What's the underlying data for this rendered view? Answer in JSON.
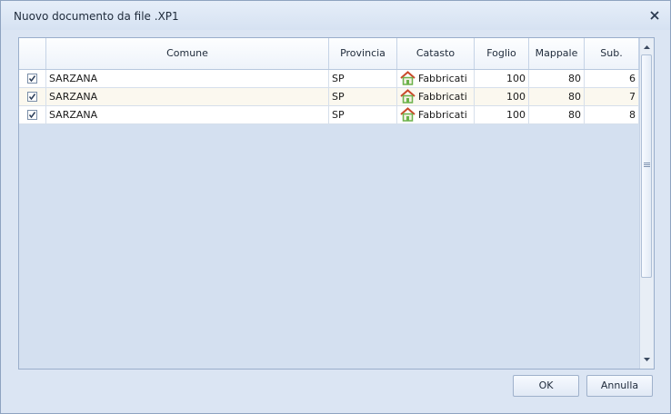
{
  "window": {
    "title": "Nuovo documento da file .XP1"
  },
  "grid": {
    "columns": [
      "",
      "Comune",
      "Provincia",
      "Catasto",
      "Foglio",
      "Mappale",
      "Sub."
    ],
    "rows": [
      {
        "checked": true,
        "comune": "SARZANA",
        "provincia": "SP",
        "catasto": "Fabbricati",
        "foglio": "100",
        "mappale": "80",
        "sub": "6"
      },
      {
        "checked": true,
        "comune": "SARZANA",
        "provincia": "SP",
        "catasto": "Fabbricati",
        "foglio": "100",
        "mappale": "80",
        "sub": "7"
      },
      {
        "checked": true,
        "comune": "SARZANA",
        "provincia": "SP",
        "catasto": "Fabbricati",
        "foglio": "100",
        "mappale": "80",
        "sub": "8"
      }
    ],
    "catasto_icon": "house-icon"
  },
  "buttons": {
    "ok": "OK",
    "cancel": "Annulla"
  },
  "colors": {
    "row_alt": "#fbf8ef",
    "row": "#ffffff",
    "house_roof": "#c94a2a",
    "house_body": "#6bb24a"
  }
}
